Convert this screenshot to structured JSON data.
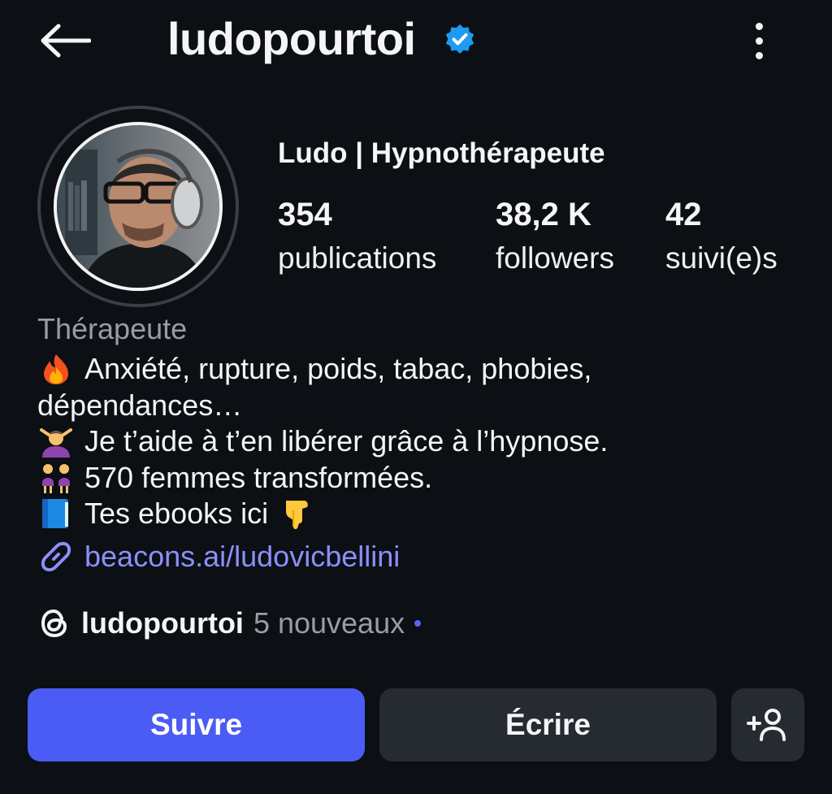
{
  "header": {
    "username": "ludopourtoi",
    "back_icon": "arrow-left-icon",
    "verified_icon": "verified-badge-icon",
    "more_icon": "vertical-dots-icon"
  },
  "profile": {
    "display_name": "Ludo | Hypnothérapeute",
    "avatar_icon": "profile-photo",
    "stats": [
      {
        "value": "354",
        "label": "publications"
      },
      {
        "value": "38,2 K",
        "label": "followers"
      },
      {
        "value": "42",
        "label": "suivi(e)s"
      }
    ]
  },
  "bio": {
    "category": "Thérapeute",
    "lines": [
      {
        "emoji": "fire-emoji",
        "text": "Anxiété, rupture, poids, tabac, phobies,"
      },
      {
        "emoji": "",
        "text": "dépendances…"
      },
      {
        "emoji": "woman-getting-massage-emoji",
        "text": "Je t’aide à t’en libérer grâce à l’hypnose."
      },
      {
        "emoji": "two-women-emoji",
        "text": "570 femmes transformées."
      },
      {
        "emoji": "blue-book-emoji",
        "text": "Tes ebooks ici"
      }
    ],
    "trailing_emoji": "backhand-index-pointing-down-emoji",
    "link": "beacons.ai/ludovicbellini",
    "link_icon": "link-icon"
  },
  "threads": {
    "icon": "threads-icon",
    "username": "ludopourtoi",
    "new_count_text": "5 nouveaux"
  },
  "actions": {
    "follow_label": "Suivre",
    "message_label": "Écrire",
    "add_user_icon": "add-person-icon"
  },
  "colors": {
    "background": "#0c0f14",
    "accent": "#4b5cf4",
    "link": "#8d8ffb",
    "verified": "#1d9bf0",
    "secondary_button": "#262a31"
  }
}
